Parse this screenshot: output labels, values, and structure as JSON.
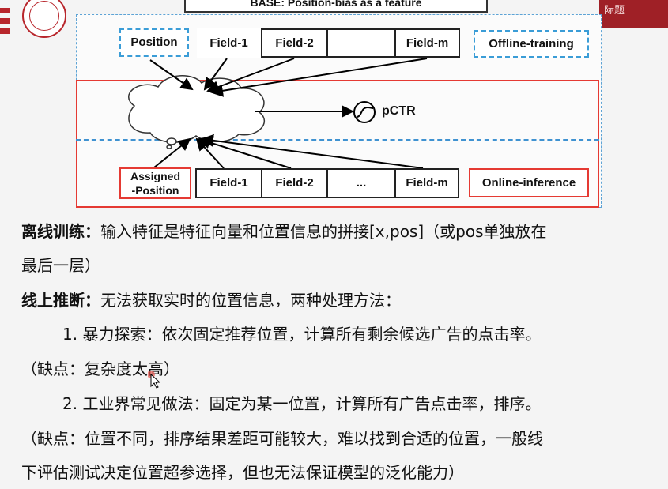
{
  "header": {
    "band_text": "际题"
  },
  "diagram": {
    "title": "BASE: Position-bias as a feature",
    "offline_row": {
      "position_label": "Position",
      "fields": [
        "Field-1",
        "Field-2",
        "",
        "Field-m"
      ],
      "tag": "Offline-training"
    },
    "output_label": "pCTR",
    "online_row": {
      "assigned_label": "Assigned\n-Position",
      "fields": [
        "Field-1",
        "Field-2",
        "...",
        "Field-m"
      ],
      "tag": "Online-inference"
    }
  },
  "text": {
    "p1_lead": "离线训练：",
    "p1_body": "输入特征是特征向量和位置信息的拼接[x,pos]（或pos单独放在",
    "p1_cont": "最后一层）",
    "p2_lead": "线上推断：",
    "p2_body": "无法获取实时的位置信息，两种处理方法：",
    "item1": "1. 暴力探索：依次固定推荐位置，计算所有剩余候选广告的点击率。",
    "item1_note": "（缺点：复杂度太高）",
    "item2": "2. 工业界常见做法：固定为某一位置，计算所有广告点击率，排序。",
    "item2_note1": "（缺点：位置不同，排序结果差距可能较大，难以找到合适的位置，一般线",
    "item2_note2": "下评估测试决定位置超参选择，但也无法保证模型的泛化能力）"
  },
  "colors": {
    "accent_red": "#e53a33",
    "accent_blue": "#3b9dd7",
    "brand_red": "#b8262c"
  }
}
